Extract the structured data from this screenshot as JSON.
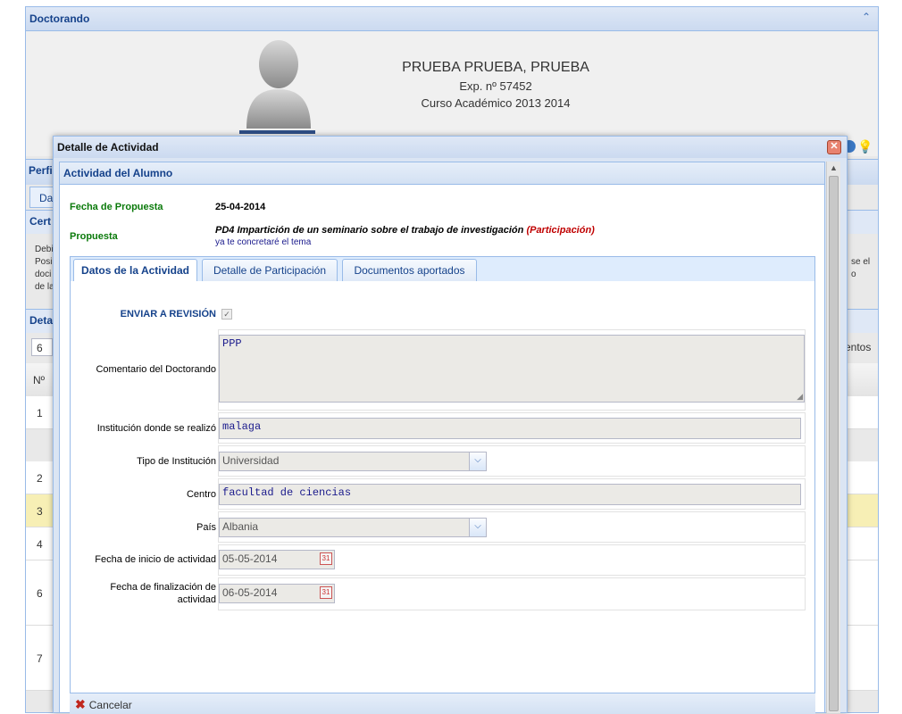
{
  "background": {
    "panel_title": "Doctorando",
    "student_name": "PRUEBA PRUEBA, PRUEBA",
    "expediente": "Exp. nº 57452",
    "curso": "Curso Académico 2013 2014",
    "fragments": {
      "perfil": "Perfi",
      "tab_da": "Da",
      "cert": "Cert",
      "deb": "Debi",
      "pos": "Posi",
      "doc": "doci",
      "dela": "de la",
      "detalle": "Deta",
      "seis": "6",
      "num_header": "Nº",
      "right_text1": "se el",
      "right_text2": "o",
      "right_text3": "entos"
    },
    "rows": [
      "1",
      "2",
      "3",
      "4",
      "6",
      "7"
    ]
  },
  "dialog": {
    "title": "Detalle de Actividad",
    "inner_title": "Actividad del Alumno",
    "fecha_label": "Fecha de Propuesta",
    "fecha_value": "25-04-2014",
    "propuesta_label": "Propuesta",
    "propuesta_code": "PD4 Impartición de un seminario sobre el trabajo de investigación",
    "propuesta_type": "(Participación)",
    "propuesta_note": "ya te concretaré el tema",
    "tabs": [
      "Datos de la Actividad",
      "Detalle de Participación",
      "Documentos aportados"
    ],
    "enviar_label": "ENVIAR A REVISIÓN",
    "comentario_label": "Comentario del Doctorando",
    "comentario_value": "PPP",
    "institucion_label": "Institución donde se realizó",
    "institucion_value": "malaga",
    "tipo_label": "Tipo de Institución",
    "tipo_value": "Universidad",
    "centro_label": "Centro",
    "centro_value": "facultad de ciencias",
    "pais_label": "País",
    "pais_value": "Albania",
    "inicio_label": "Fecha de inicio de actividad",
    "inicio_value": "05-05-2014",
    "fin_label_1": "Fecha de finalización de",
    "fin_label_2": "actividad",
    "fin_value": "06-05-2014",
    "cancel_label": "Cancelar"
  },
  "colors": {
    "header_blue": "#15428b",
    "border_blue": "#99bbe8",
    "green_label": "#0b7a0b",
    "red_type": "#c00000",
    "row_highlight": "#f7efb5"
  }
}
